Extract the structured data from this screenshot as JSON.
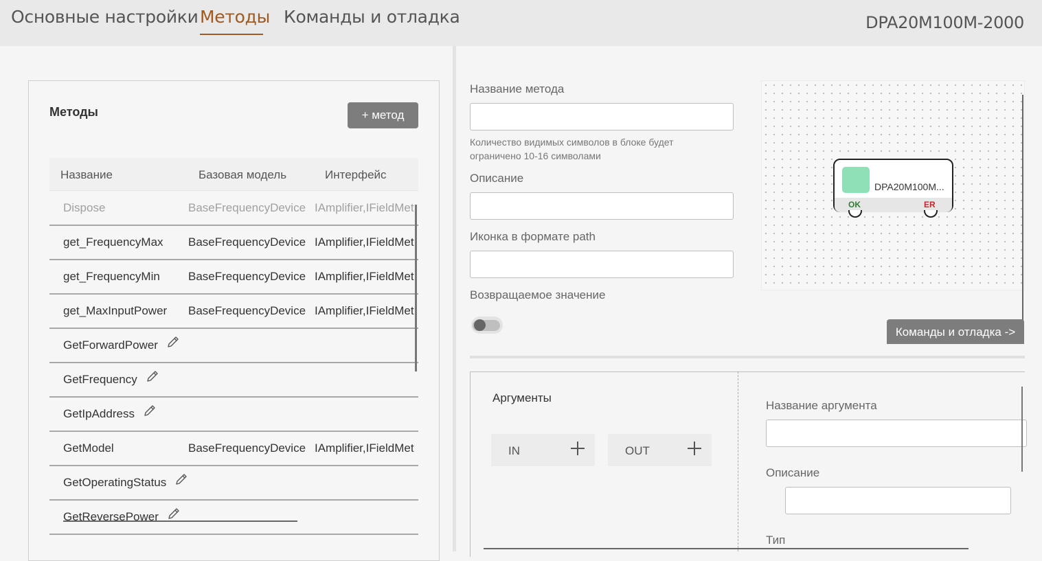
{
  "nav": {
    "tabs": [
      "Основные настройки",
      "Методы",
      "Команды и отладка"
    ],
    "active_tab": "Методы",
    "device_title": "DPA20M100M-2000",
    "accent_color": "#a0591f"
  },
  "methods": {
    "title": "Методы",
    "add_button": "+ метод",
    "columns": [
      "Название",
      "Базовая модель",
      "Интерфейс"
    ],
    "rows": [
      {
        "name": "Dispose",
        "base": "BaseFrequencyDevice",
        "iface": "IAmplifier,IFieldMet",
        "muted": true
      },
      {
        "name": "get_FrequencyMax",
        "base": "BaseFrequencyDevice",
        "iface": "IAmplifier,IFieldMet"
      },
      {
        "name": "get_FrequencyMin",
        "base": "BaseFrequencyDevice",
        "iface": "IAmplifier,IFieldMet"
      },
      {
        "name": "get_MaxInputPower",
        "base": "BaseFrequencyDevice",
        "iface": "IAmplifier,IFieldMet"
      },
      {
        "name": "GetForwardPower",
        "base": "",
        "iface": "",
        "editable": true
      },
      {
        "name": "GetFrequency",
        "base": "",
        "iface": "",
        "editable": true
      },
      {
        "name": "GetIpAddress",
        "base": "",
        "iface": "",
        "editable": true
      },
      {
        "name": "GetModel",
        "base": "BaseFrequencyDevice",
        "iface": "IAmplifier,IFieldMet"
      },
      {
        "name": "GetOperatingStatus",
        "base": "",
        "iface": "",
        "editable": true
      },
      {
        "name": "GetReversePower",
        "base": "",
        "iface": "",
        "editable": true
      }
    ]
  },
  "form": {
    "method_name_label": "Название метода",
    "method_name_value": "",
    "hint": "Количество видимых символов в блоке будет ограничено 10-16 символами",
    "description_label": "Описание",
    "description_value": "",
    "icon_path_label": "Иконка в формате path",
    "icon_path_value": "",
    "return_value_label": "Возвращаемое значение",
    "return_value_enabled": false
  },
  "node": {
    "label": "DPA20M100M...",
    "ok": "OK",
    "er": "ER",
    "icon_color": "#8fe0b7"
  },
  "debug_button": "Команды и отладка ->",
  "arguments": {
    "title": "Аргументы",
    "in_label": "IN",
    "out_label": "OUT",
    "arg_name_label": "Название аргумента",
    "arg_name_value": "",
    "arg_description_label": "Описание",
    "arg_description_value": "",
    "type_label": "Тип"
  }
}
